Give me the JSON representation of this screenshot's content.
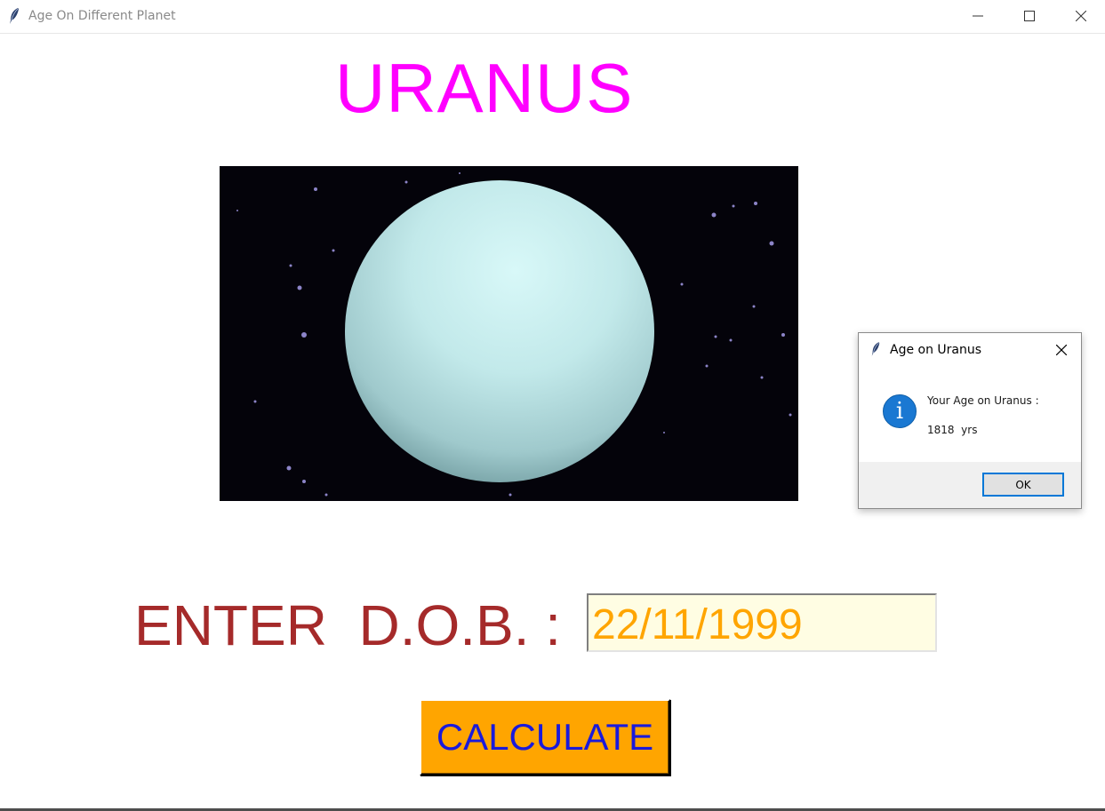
{
  "window": {
    "title": "Age On Different Planet",
    "icon": "feather-icon"
  },
  "main": {
    "planet_name": "URANUS",
    "planet_image_alt": "uranus-planet-image",
    "dob_label": "ENTER  D.O.B. :",
    "dob_value": "22/11/1999",
    "calculate_label": "CALCULATE"
  },
  "dialog": {
    "title": "Age on Uranus",
    "icon": "info-icon",
    "message_line1": "Your Age on Uranus :",
    "message_line2": "1818  yrs",
    "ok_label": "OK"
  },
  "colors": {
    "planet_title": "#ff00ff",
    "dob_label": "#a52a2a",
    "dob_text": "#ffa500",
    "dob_bg": "#fffde3",
    "button_bg": "#ffa500",
    "button_text": "#1a1adb",
    "dialog_accent": "#0078d7"
  }
}
